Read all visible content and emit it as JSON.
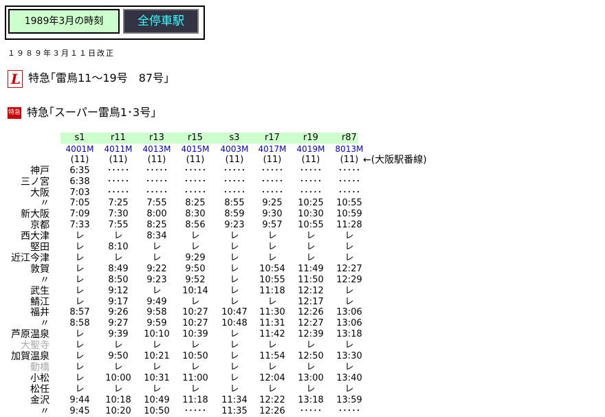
{
  "tabs": {
    "timetable": "1989年3月の時刻",
    "all_stations": "全停車駅"
  },
  "revision": "１９８９年３月１１日改正",
  "headers": [
    {
      "icon": "limited-express-l-icon",
      "text": "特急｢雷鳥11～19号　87号｣"
    },
    {
      "icon": "tokkyu-badge-icon",
      "badge": "特急",
      "text": "特急｢スーパー雷鳥1･3号｣"
    }
  ],
  "trains": [
    {
      "name": "s1",
      "number": "4001M",
      "track": "(11)"
    },
    {
      "name": "r11",
      "number": "4011M",
      "track": "(11)"
    },
    {
      "name": "r13",
      "number": "4013M",
      "track": "(11)"
    },
    {
      "name": "r15",
      "number": "4015M",
      "track": "(11)"
    },
    {
      "name": "s3",
      "number": "4003M",
      "track": "(11)"
    },
    {
      "name": "r17",
      "number": "4017M",
      "track": "(11)"
    },
    {
      "name": "r19",
      "number": "4019M",
      "track": "(11)"
    },
    {
      "name": "r87",
      "number": "8013M",
      "track": "(11)"
    }
  ],
  "track_note": "←(大阪駅番線)",
  "rows": [
    {
      "station": "神戸",
      "times": [
        "6:35",
        "･････",
        "･････",
        "･････",
        "･････",
        "･････",
        "･････",
        "･････"
      ]
    },
    {
      "station": "三ノ宮",
      "times": [
        "6:38",
        "･････",
        "･････",
        "･････",
        "･････",
        "･････",
        "･････",
        "･････"
      ]
    },
    {
      "station": "大阪",
      "times": [
        "7:03",
        "･････",
        "･････",
        "･････",
        "･････",
        "･････",
        "･････",
        "･････"
      ]
    },
    {
      "station": "〃",
      "times": [
        "7:05",
        "7:25",
        "7:55",
        "8:25",
        "8:55",
        "9:25",
        "10:25",
        "10:55"
      ]
    },
    {
      "station": "新大阪",
      "times": [
        "7:09",
        "7:30",
        "8:00",
        "8:30",
        "8:59",
        "9:30",
        "10:30",
        "10:59"
      ]
    },
    {
      "station": "京都",
      "times": [
        "7:33",
        "7:55",
        "8:25",
        "8:56",
        "9:23",
        "9:57",
        "10:55",
        "11:28"
      ]
    },
    {
      "station": "西大津",
      "times": [
        "レ",
        "レ",
        "8:34",
        "レ",
        "レ",
        "レ",
        "レ",
        "レ"
      ]
    },
    {
      "station": "堅田",
      "times": [
        "レ",
        "8:10",
        "レ",
        "レ",
        "レ",
        "レ",
        "レ",
        "レ"
      ]
    },
    {
      "station": "近江今津",
      "times": [
        "レ",
        "レ",
        "レ",
        "9:29",
        "レ",
        "レ",
        "レ",
        "レ"
      ]
    },
    {
      "station": "敦賀",
      "times": [
        "レ",
        "8:49",
        "9:22",
        "9:50",
        "レ",
        "10:54",
        "11:49",
        "12:27"
      ]
    },
    {
      "station": "〃",
      "times": [
        "レ",
        "8:50",
        "9:23",
        "9:52",
        "レ",
        "10:55",
        "11:50",
        "12:29"
      ]
    },
    {
      "station": "武生",
      "times": [
        "レ",
        "9:12",
        "レ",
        "10:14",
        "レ",
        "11:18",
        "12:12",
        "レ"
      ]
    },
    {
      "station": "鯖江",
      "times": [
        "レ",
        "9:17",
        "9:49",
        "レ",
        "レ",
        "レ",
        "12:17",
        "レ"
      ]
    },
    {
      "station": "福井",
      "times": [
        "8:57",
        "9:26",
        "9:58",
        "10:27",
        "10:47",
        "11:30",
        "12:26",
        "13:06"
      ]
    },
    {
      "station": "〃",
      "times": [
        "8:58",
        "9:27",
        "9:59",
        "10:27",
        "10:48",
        "11:31",
        "12:27",
        "13:06"
      ]
    },
    {
      "station": "芦原温泉",
      "times": [
        "レ",
        "9:39",
        "10:10",
        "10:39",
        "レ",
        "11:42",
        "12:39",
        "13:18"
      ]
    },
    {
      "station": "大聖寺",
      "gray": true,
      "times": [
        "レ",
        "レ",
        "レ",
        "レ",
        "レ",
        "レ",
        "レ",
        "レ"
      ]
    },
    {
      "station": "加賀温泉",
      "times": [
        "レ",
        "9:50",
        "10:21",
        "10:50",
        "レ",
        "11:54",
        "12:50",
        "13:30"
      ]
    },
    {
      "station": "動橋",
      "gray": true,
      "times": [
        "レ",
        "レ",
        "レ",
        "レ",
        "レ",
        "レ",
        "レ",
        "レ"
      ]
    },
    {
      "station": "小松",
      "times": [
        "レ",
        "10:00",
        "10:31",
        "11:00",
        "レ",
        "12:04",
        "13:00",
        "13:40"
      ]
    },
    {
      "station": "松任",
      "times": [
        "レ",
        "レ",
        "レ",
        "レ",
        "レ",
        "レ",
        "レ",
        "レ"
      ]
    },
    {
      "station": "金沢",
      "times": [
        "9:44",
        "10:18",
        "10:49",
        "11:18",
        "11:34",
        "12:22",
        "13:18",
        "13:59"
      ]
    },
    {
      "station": "〃",
      "times": [
        "9:45",
        "10:20",
        "10:50",
        "･････",
        "11:35",
        "12:26",
        "･････",
        "･････"
      ]
    }
  ]
}
